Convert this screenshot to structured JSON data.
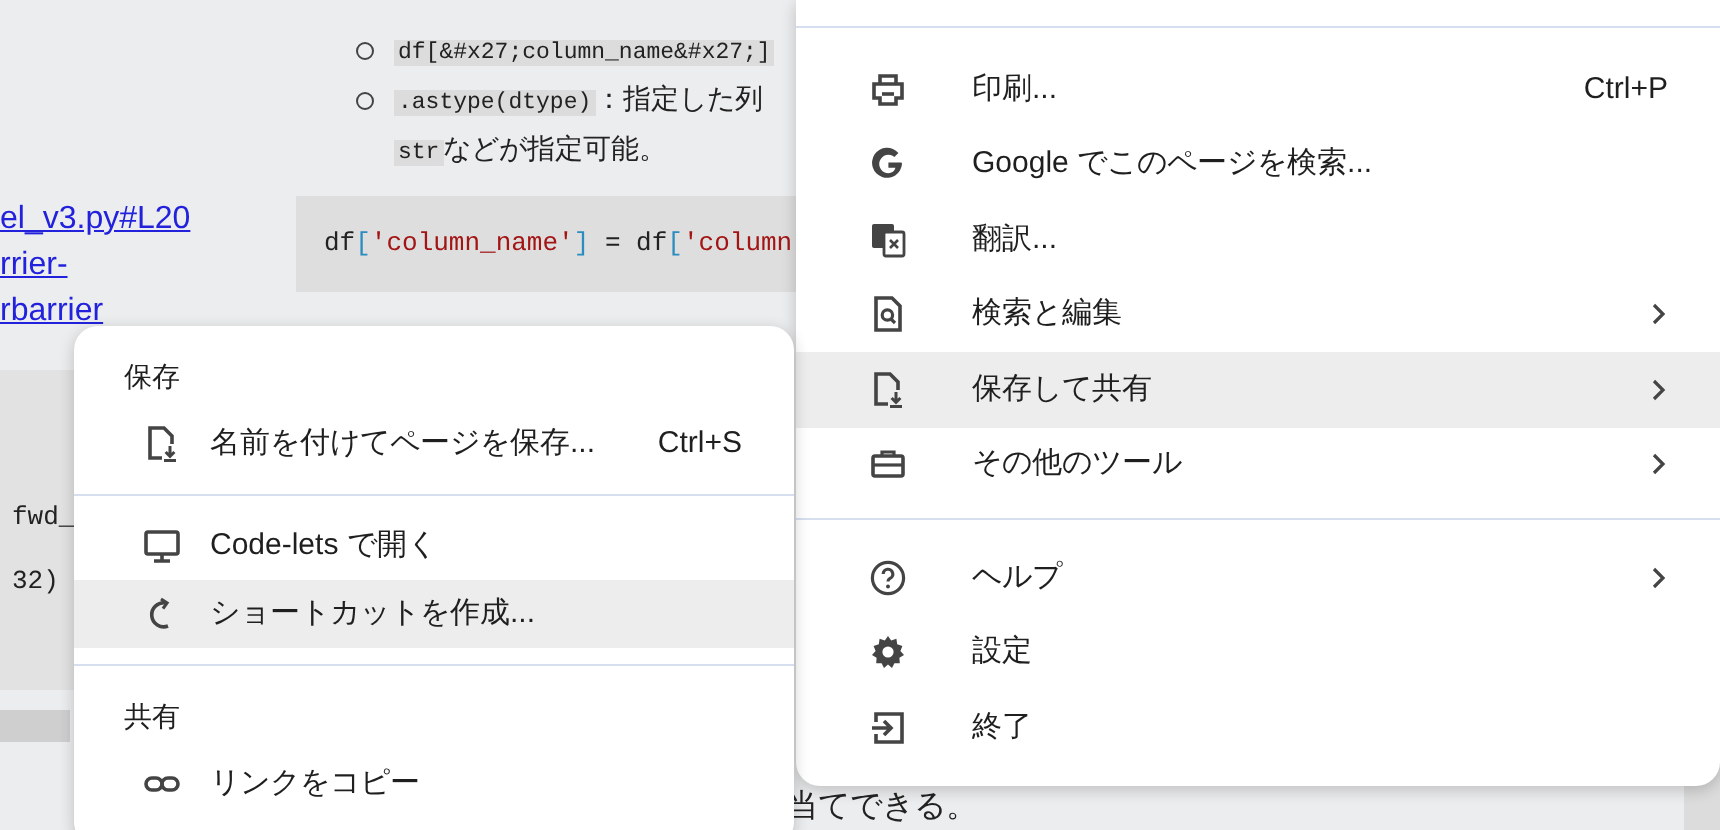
{
  "page": {
    "bullets": [
      {
        "segments": [
          {
            "kind": "code",
            "text": "df[&#x27;column_name&#x27;]"
          }
        ]
      },
      {
        "segments": [
          {
            "kind": "code",
            "text": ".astype(dtype)"
          },
          {
            "kind": "text",
            "text": "：指定した列"
          }
        ],
        "continuation": [
          {
            "kind": "code",
            "text": "str"
          },
          {
            "kind": "text",
            "text": "などが指定可能。"
          }
        ]
      }
    ],
    "links": [
      "el_v3.py#L20",
      "rrier-",
      "rbarrier"
    ],
    "code_line": [
      {
        "kind": "plain",
        "text": "df"
      },
      {
        "kind": "bracket",
        "text": "["
      },
      {
        "kind": "string",
        "text": "'column_name'"
      },
      {
        "kind": "bracket",
        "text": "]"
      },
      {
        "kind": "plain",
        "text": " = df"
      },
      {
        "kind": "bracket",
        "text": "["
      },
      {
        "kind": "string",
        "text": "'column"
      }
    ],
    "dark_code_lines": [
      "fwd_",
      "32)"
    ],
    "footer_text": "当てできる。"
  },
  "main_menu": {
    "items": [
      {
        "kind": "item",
        "label": "印刷...",
        "shortcut": "Ctrl+P",
        "submenu": false,
        "selected": false
      },
      {
        "kind": "item",
        "label": "Google でこのページを検索...",
        "submenu": false,
        "selected": false
      },
      {
        "kind": "item",
        "label": "翻訳...",
        "submenu": false,
        "selected": false
      },
      {
        "kind": "item",
        "label": "検索と編集",
        "submenu": true,
        "selected": false
      },
      {
        "kind": "item",
        "label": "保存して共有",
        "submenu": true,
        "selected": true
      },
      {
        "kind": "item",
        "label": "その他のツール",
        "submenu": true,
        "selected": false
      },
      {
        "kind": "divider"
      },
      {
        "kind": "item",
        "label": "ヘルプ",
        "submenu": true,
        "selected": false
      },
      {
        "kind": "item",
        "label": "設定",
        "submenu": false,
        "selected": false
      },
      {
        "kind": "item",
        "label": "終了",
        "submenu": false,
        "selected": false
      }
    ]
  },
  "sub_menu": {
    "items": [
      {
        "kind": "header",
        "label": "保存"
      },
      {
        "kind": "item",
        "label": "名前を付けてページを保存...",
        "shortcut": "Ctrl+S",
        "selected": false
      },
      {
        "kind": "divider"
      },
      {
        "kind": "item",
        "label": "Code-lets で開く",
        "selected": false
      },
      {
        "kind": "item",
        "label": "ショートカットを作成...",
        "selected": true
      },
      {
        "kind": "divider"
      },
      {
        "kind": "header",
        "label": "共有"
      },
      {
        "kind": "item",
        "label": "リンクをコピー",
        "selected": false
      }
    ]
  }
}
